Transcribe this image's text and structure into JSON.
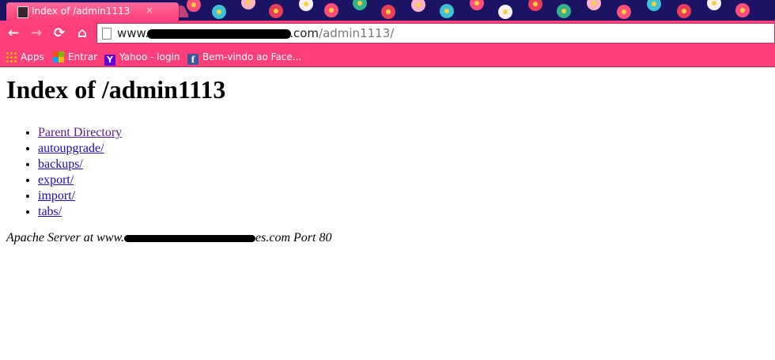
{
  "browser": {
    "tab_title": "Index of /admin1113",
    "tab_close": "×",
    "url_prefix": "www.",
    "url_domain_suffix": ".com",
    "url_path": "/admin1113/",
    "back_glyph": "←",
    "forward_glyph": "→",
    "reload_glyph": "⟳",
    "home_glyph": "⌂",
    "accent_color": "#ff3f7b"
  },
  "bookmarks": [
    {
      "label": "Apps",
      "icon": "apps-grid-icon"
    },
    {
      "label": "Entrar",
      "icon": "windows-logo-icon"
    },
    {
      "label": "Yahoo - login",
      "icon": "yahoo-logo-icon"
    },
    {
      "label": "Bem-vindo ao Face...",
      "icon": "facebook-logo-icon"
    }
  ],
  "page": {
    "heading": "Index of /admin1113",
    "entries": [
      "Parent Directory",
      "autoupgrade/",
      "backups/",
      "export/",
      "import/",
      "tabs/"
    ],
    "footer_prefix": "Apache Server at www.",
    "footer_suffix": "es.com Port 80"
  }
}
